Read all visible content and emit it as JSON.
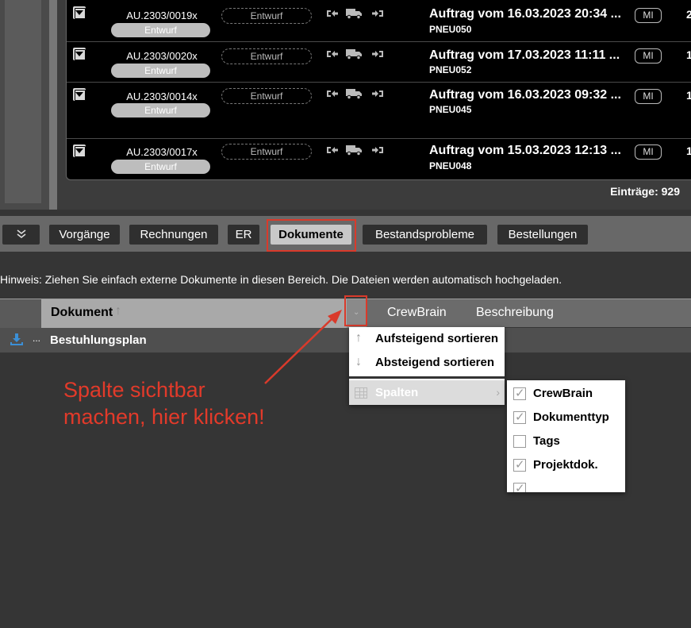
{
  "orders": [
    {
      "number": "AU.2303/0019x",
      "badge": "Entwurf",
      "status": "Entwurf",
      "title": "Auftrag vom 16.03.2023 20:34 ...",
      "code": "PNEU050",
      "tag": "MI",
      "right": "2"
    },
    {
      "number": "AU.2303/0020x",
      "badge": "Entwurf",
      "status": "Entwurf",
      "title": "Auftrag vom 17.03.2023 11:11 ...",
      "code": "PNEU052",
      "tag": "MI",
      "right": "1"
    },
    {
      "number": "AU.2303/0014x",
      "badge": "Entwurf",
      "status": "Entwurf",
      "title": "Auftrag vom 16.03.2023 09:32 ...",
      "code": "PNEU045",
      "tag": "MI",
      "right": "1"
    },
    {
      "number": "AU.2303/0017x",
      "badge": "Entwurf",
      "status": "Entwurf",
      "title": "Auftrag vom 15.03.2023 12:13 ...",
      "code": "PNEU048",
      "tag": "MI",
      "right": "1"
    }
  ],
  "entries_label": "Einträge: 929",
  "tabs": {
    "collapse": "»",
    "vorgaenge": "Vorgänge",
    "rechnungen": "Rechnungen",
    "er": "ER",
    "dokumente": "Dokumente",
    "bestandsprobleme": "Bestandsprobleme",
    "bestellungen": "Bestellungen"
  },
  "hint": "Hinweis: Ziehen Sie einfach externe Dokumente in diesen Bereich. Die Dateien werden automatisch hochgeladen.",
  "grid": {
    "col_document": "Dokument",
    "col_crewbrain": "CrewBrain",
    "col_description": "Beschreibung",
    "row_dots": "...",
    "row_name": "Bestuhlungsplan"
  },
  "context_menu": {
    "sort_asc": "Aufsteigend sortieren",
    "sort_desc": "Absteigend sortieren",
    "columns": "Spalten"
  },
  "columns_menu": [
    {
      "label": "CrewBrain",
      "checked": true
    },
    {
      "label": "Dokumenttyp",
      "checked": true
    },
    {
      "label": "Tags",
      "checked": false
    },
    {
      "label": "Projektdok.",
      "checked": true
    },
    {
      "label": "",
      "checked": true
    }
  ],
  "annotation": {
    "line1": "Spalte sichtbar",
    "line2": "machen, hier klicken!"
  },
  "colors": {
    "accent_red": "#d93a2b",
    "active_tab": "#c8c8c8"
  }
}
